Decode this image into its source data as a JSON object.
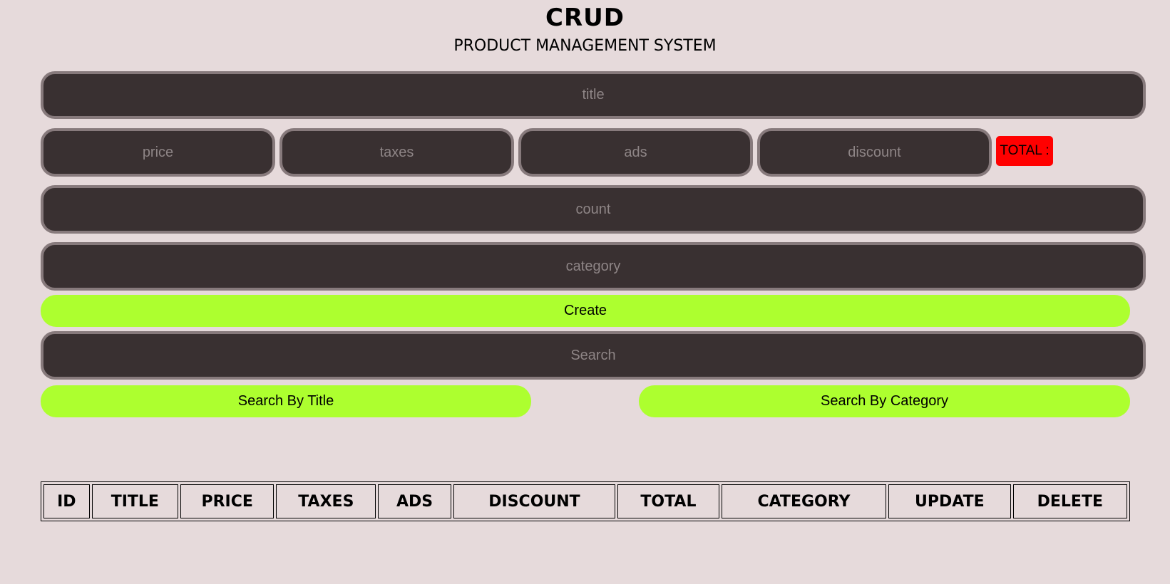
{
  "header": {
    "title": "CRUD",
    "subtitle": "PRODUCT MANAGEMENT SYSTEM"
  },
  "form": {
    "title_placeholder": "title",
    "price_placeholder": "price",
    "taxes_placeholder": "taxes",
    "ads_placeholder": "ads",
    "discount_placeholder": "discount",
    "total_label": "TOTAL :",
    "count_placeholder": "count",
    "category_placeholder": "category",
    "create_label": "Create"
  },
  "search": {
    "placeholder": "Search",
    "by_title_label": "Search By Title",
    "by_category_label": "Search By Category"
  },
  "table": {
    "columns": [
      "ID",
      "TITLE",
      "PRICE",
      "TAXES",
      "ADS",
      "DISCOUNT",
      "TOTAL",
      "CATEGORY",
      "UPDATE",
      "DELETE"
    ]
  },
  "colors": {
    "background": "#e6dadb",
    "input_background": "#393031",
    "input_border": "#877a7c",
    "button_accent": "#adff2f",
    "total_badge": "#ff0000"
  }
}
